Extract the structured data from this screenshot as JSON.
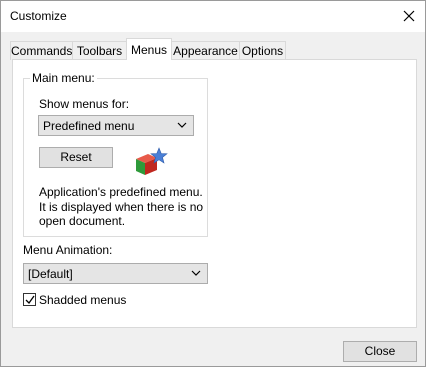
{
  "window": {
    "title": "Customize"
  },
  "tabs": [
    {
      "label": "Commands",
      "active": false
    },
    {
      "label": "Toolbars",
      "active": false
    },
    {
      "label": "Menus",
      "active": true
    },
    {
      "label": "Appearance",
      "active": false
    },
    {
      "label": "Options",
      "active": false
    }
  ],
  "main_menu": {
    "group_label": "Main menu:",
    "show_menus_label": "Show menus for:",
    "show_menus_value": "Predefined menu",
    "reset_label": "Reset",
    "app_icon": "app-cube-star-icon",
    "description": "Application's predefined menu. It is displayed when there is no open document."
  },
  "animation": {
    "label": "Menu Animation:",
    "value": "[Default]"
  },
  "shaded_menus": {
    "label": "Shadded menus",
    "checked": true
  },
  "footer": {
    "close_label": "Close"
  }
}
